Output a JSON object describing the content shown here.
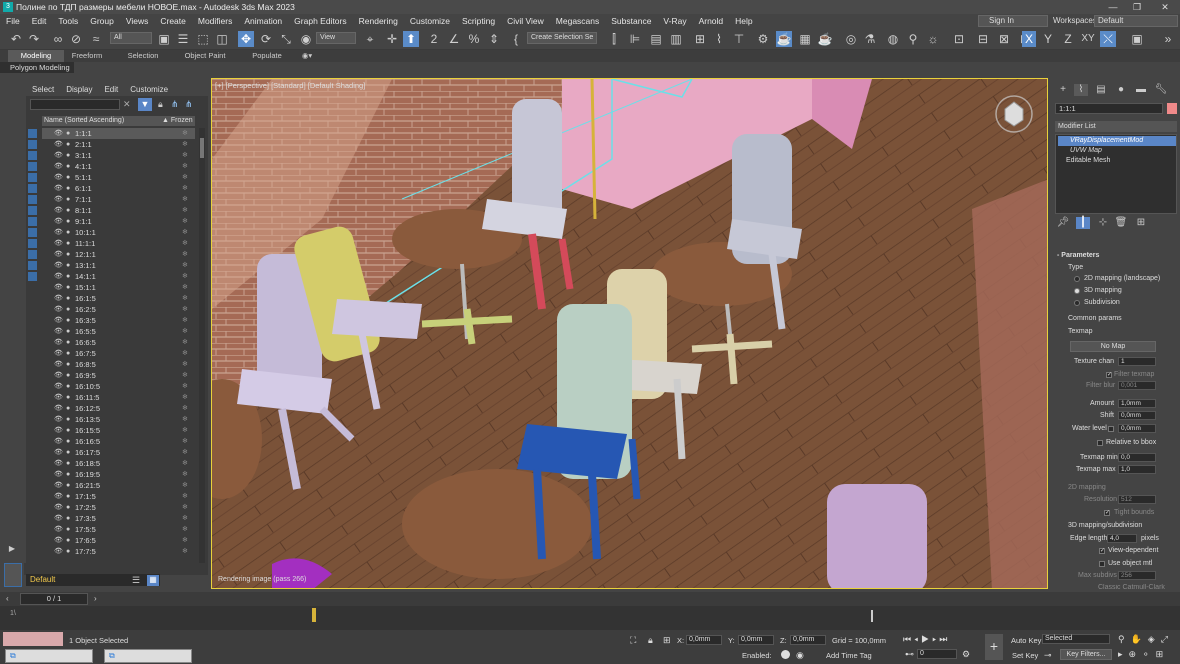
{
  "window": {
    "title": "Полине по ТДП размеры мебели НОВОЕ.max - Autodesk 3ds Max 2023",
    "minimize": "—",
    "maximize": "❐",
    "close": "✕"
  },
  "menu": [
    "File",
    "Edit",
    "Tools",
    "Group",
    "Views",
    "Create",
    "Modifiers",
    "Animation",
    "Graph Editors",
    "Rendering",
    "Customize",
    "Scripting",
    "Civil View",
    "Megascans",
    "Substance",
    "V-Ray",
    "Arnold",
    "Help"
  ],
  "signin": "Sign In",
  "workspaces_label": "Workspaces:",
  "workspaces_value": "Default",
  "toolbar": {
    "selection_filter": "All",
    "ref_coord": "View",
    "named_selection": "Create Selection Se",
    "axis_x": "X",
    "axis_y": "Y",
    "axis_z": "Z",
    "axis_xy": "XY"
  },
  "ribbon": {
    "tabs": [
      "Modeling",
      "Freeform",
      "Selection",
      "Object Paint",
      "Populate"
    ],
    "sub": "Polygon Modeling"
  },
  "explorer": {
    "menu": [
      "Select",
      "Display",
      "Edit",
      "Customize"
    ],
    "col_name": "Name (Sorted Ascending)",
    "col_frozen": "▲ Frozen",
    "rows": [
      "1:1:1",
      "2:1:1",
      "3:1:1",
      "4:1:1",
      "5:1:1",
      "6:1:1",
      "7:1:1",
      "8:1:1",
      "9:1:1",
      "10:1:1",
      "11:1:1",
      "12:1:1",
      "13:1:1",
      "14:1:1",
      "15:1:1",
      "16:1:5",
      "16:2:5",
      "16:3:5",
      "16:5:5",
      "16:6:5",
      "16:7:5",
      "16:8:5",
      "16:9:5",
      "16:10:5",
      "16:11:5",
      "16:12:5",
      "16:13:5",
      "16:15:5",
      "16:16:5",
      "16:17:5",
      "16:18:5",
      "16:19:5",
      "16:21:5",
      "17:1:5",
      "17:2:5",
      "17:3:5",
      "17:5:5",
      "17:6:5",
      "17:7:5"
    ],
    "layer": "Default"
  },
  "viewport": {
    "label": "[+] [Perspective] [Standard] [Default Shading]",
    "status": "Rendering image (pass 266)"
  },
  "command_panel": {
    "object_name": "1:1:1",
    "modifier_list": "Modifier List",
    "stack": [
      "VRayDisplacementMod",
      "UVW Map",
      "Editable Mesh"
    ],
    "rollout": "Parameters",
    "type_label": "Type",
    "type_options": [
      "2D mapping (landscape)",
      "3D mapping",
      "Subdivision"
    ],
    "common_params": "Common params",
    "texmap": "Texmap",
    "no_map": "No Map",
    "texture_chan_label": "Texture chan",
    "texture_chan": "1",
    "filter_texmap": "Filter texmap",
    "filter_blur_label": "Filter blur",
    "filter_blur": "0,001",
    "amount_label": "Amount",
    "amount": "1,0mm",
    "shift_label": "Shift",
    "shift": "0,0mm",
    "water_label": "Water level",
    "water": "0,0mm",
    "relative_bbox": "Relative to bbox",
    "texmap_min_label": "Texmap min",
    "texmap_min": "0,0",
    "texmap_max_label": "Texmap max",
    "texmap_max": "1,0",
    "mapping2d": "2D mapping",
    "resolution_label": "Resolution",
    "resolution": "512",
    "tight_bounds": "Tight bounds",
    "mapping3d": "3D mapping/subdivision",
    "edge_length_label": "Edge length",
    "edge_length": "4,0",
    "pixels": "pixels",
    "view_dependent": "View-dependent",
    "use_object_mtl": "Use object mtl",
    "max_subdivs_label": "Max subdivs",
    "max_subdivs": "256",
    "classic_catmull": "Classic Catmull-Clark"
  },
  "timeline": {
    "frame": "0 / 1",
    "current": "1\\"
  },
  "status": {
    "selection": "1 Object Selected",
    "x_label": "X:",
    "x": "0,0mm",
    "y_label": "Y:",
    "y": "0,0mm",
    "z_label": "Z:",
    "z": "0,0mm",
    "grid": "Grid = 100,0mm",
    "enabled": "Enabled:",
    "add_time_tag": "Add Time Tag",
    "auto_key": "Auto Key",
    "set_key": "Set Key",
    "selected": "Selected",
    "key_filters": "Key Filters...",
    "frame_field": "0"
  }
}
